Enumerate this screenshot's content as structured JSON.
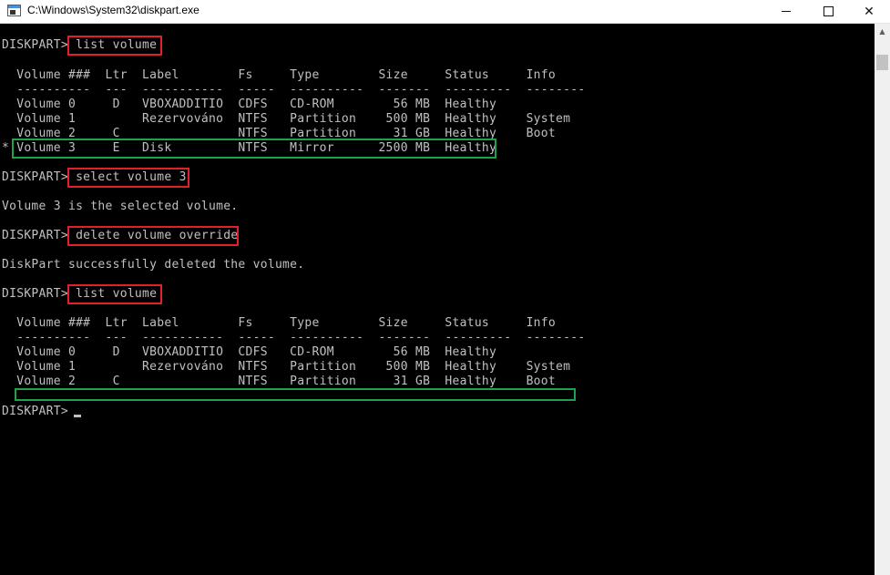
{
  "window": {
    "title": "C:\\Windows\\System32\\diskpart.exe",
    "minimize_glyph": "minimize-icon",
    "maximize_glyph": "maximize-icon",
    "close_glyph": "✕"
  },
  "console": {
    "prompt": "DISKPART> ",
    "commands": [
      "list volume",
      "select volume 3",
      "delete volume override",
      "list volume"
    ],
    "table1": {
      "header": "  Volume ###  Ltr  Label        Fs     Type        Size     Status     Info",
      "separator": "  ----------  ---  -----------  -----  ----------  -------  ---------  --------",
      "rows": [
        "  Volume 0     D   VBOXADDITIO  CDFS   CD-ROM        56 MB  Healthy",
        "  Volume 1         Rezervováno  NTFS   Partition    500 MB  Healthy    System",
        "  Volume 2     C                NTFS   Partition     31 GB  Healthy    Boot",
        "* Volume 3     E   Disk         NTFS   Mirror      2500 MB  Healthy"
      ]
    },
    "message_select": "Volume 3 is the selected volume.",
    "message_delete": "DiskPart successfully deleted the volume.",
    "table2": {
      "header": "  Volume ###  Ltr  Label        Fs     Type        Size     Status     Info",
      "separator": "  ----------  ---  -----------  -----  ----------  -------  ---------  --------",
      "rows": [
        "  Volume 0     D   VBOXADDITIO  CDFS   CD-ROM        56 MB  Healthy",
        "  Volume 1         Rezervováno  NTFS   Partition    500 MB  Healthy    System",
        "  Volume 2     C                NTFS   Partition     31 GB  Healthy    Boot"
      ]
    },
    "final_prompt": "DISKPART> "
  },
  "colors": {
    "console_bg": "#000000",
    "console_text": "#c0c0c0",
    "highlight_command": "#e0202a",
    "highlight_row": "#1ea34a"
  }
}
